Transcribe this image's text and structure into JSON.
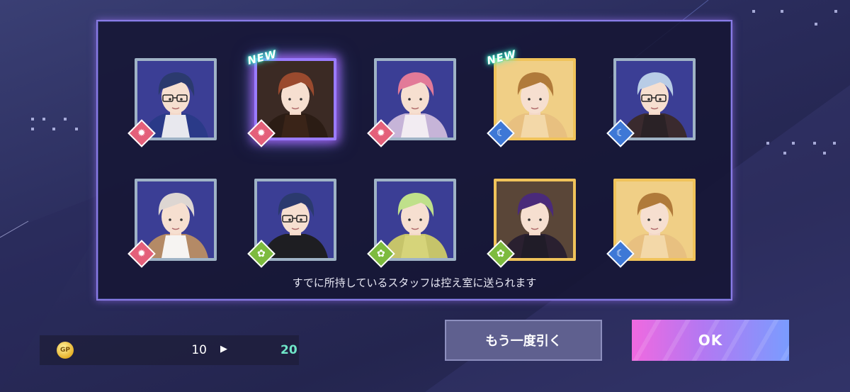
{
  "results": [
    {
      "id": "c1",
      "attribute": "sun",
      "attribute_icon": "sun-badge-icon",
      "frame": "silver",
      "is_new": false,
      "glow": false,
      "hair": "#2b3a6e",
      "bg": "#3b3e95",
      "outfit": "#e8e8ee",
      "jacket": "#2a3a88",
      "glasses": true
    },
    {
      "id": "c2",
      "attribute": "sun",
      "attribute_icon": "sun-badge-icon",
      "frame": "silver",
      "is_new": true,
      "glow": true,
      "hair": "#9a4a2e",
      "bg": "#3b2a24",
      "outfit": "#3a2418",
      "jacket": "#2b1c14",
      "glasses": false
    },
    {
      "id": "c3",
      "attribute": "sun",
      "attribute_icon": "sun-badge-icon",
      "frame": "silver",
      "is_new": false,
      "glow": false,
      "hair": "#e27a98",
      "bg": "#3b3e95",
      "outfit": "#f2ecf2",
      "jacket": "#c6b4d8",
      "glasses": false
    },
    {
      "id": "c4",
      "attribute": "moon",
      "attribute_icon": "moon-badge-icon",
      "frame": "gold",
      "is_new": true,
      "glow": false,
      "hair": "#b07a3a",
      "bg": "#f0cf86",
      "outfit": "#f3d8a8",
      "jacket": "#e8c080",
      "glasses": false
    },
    {
      "id": "c5",
      "attribute": "moon",
      "attribute_icon": "moon-badge-icon",
      "frame": "silver",
      "is_new": false,
      "glow": false,
      "hair": "#b8cce6",
      "bg": "#3b3e95",
      "outfit": "#2a2226",
      "jacket": "#3a2a2e",
      "glasses": true
    },
    {
      "id": "c6",
      "attribute": "sun",
      "attribute_icon": "sun-badge-icon",
      "frame": "silver",
      "is_new": false,
      "glow": false,
      "hair": "#ddd6d2",
      "bg": "#3b3e95",
      "outfit": "#f6f4f2",
      "jacket": "#b48a66",
      "glasses": false
    },
    {
      "id": "c7",
      "attribute": "leaf",
      "attribute_icon": "leaf-badge-icon",
      "frame": "silver",
      "is_new": false,
      "glow": false,
      "hair": "#2b3a6e",
      "bg": "#3b3e95",
      "outfit": "#1e1e22",
      "jacket": "#1e1e22",
      "glasses": true
    },
    {
      "id": "c8",
      "attribute": "leaf",
      "attribute_icon": "leaf-badge-icon",
      "frame": "silver",
      "is_new": false,
      "glow": false,
      "hair": "#bfe08a",
      "bg": "#3b3e95",
      "outfit": "#d6d47a",
      "jacket": "#c6c46a",
      "glasses": false
    },
    {
      "id": "c9",
      "attribute": "leaf",
      "attribute_icon": "leaf-badge-icon",
      "frame": "gold",
      "is_new": false,
      "glow": false,
      "hair": "#4a2a7a",
      "bg": "#5a4638",
      "outfit": "#201c28",
      "jacket": "#2a2030",
      "glasses": false
    },
    {
      "id": "c10",
      "attribute": "moon",
      "attribute_icon": "moon-badge-icon",
      "frame": "gold",
      "is_new": false,
      "glow": false,
      "hair": "#b07a3a",
      "bg": "#f0cf86",
      "outfit": "#f3d8a8",
      "jacket": "#e8c080",
      "glasses": false
    }
  ],
  "new_label": "NEW",
  "notice": "すでに所持しているスタッフは控え室に送られます",
  "gp": {
    "icon": "gp-coin-icon",
    "coin_label": "GP",
    "from": "10",
    "arrow": "▶",
    "to": "20"
  },
  "buttons": {
    "draw_again": "もう一度引く",
    "ok": "OK"
  },
  "colors": {
    "accent": "#8a7be6",
    "new_glow": "#3df5d0",
    "gp_after": "#6fe6c8",
    "sun": "#e4607a",
    "moon": "#3e78d6",
    "leaf": "#7dbb3e",
    "gold_frame": "#f0c35a"
  }
}
